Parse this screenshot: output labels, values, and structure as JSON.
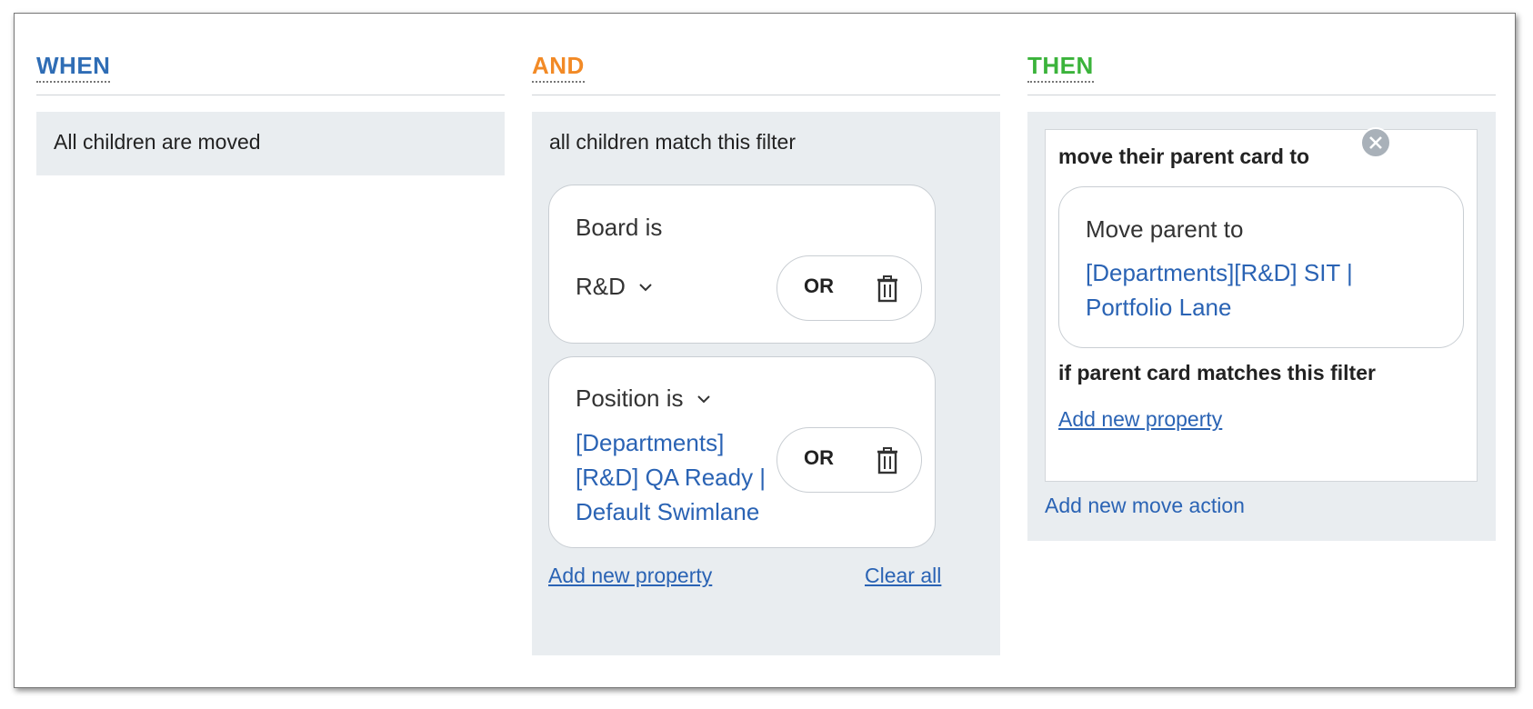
{
  "when": {
    "title": "WHEN",
    "trigger": "All children are moved"
  },
  "and": {
    "title": "AND",
    "filter_label": "all children match this filter",
    "conditions": [
      {
        "label": "Board is",
        "value": "R&D",
        "or_label": "OR"
      },
      {
        "label": "Position is",
        "value_lines": [
          "[Departments]",
          "[R&D] QA Ready |",
          "Default Swimlane"
        ],
        "or_label": "OR"
      }
    ],
    "add_property": "Add new property",
    "clear_all": "Clear all"
  },
  "then": {
    "title": "THEN",
    "action_label": "move their parent card to",
    "move_card": {
      "label": "Move parent to",
      "target_lines": [
        "[Departments][R&D] SIT |",
        "Portfolio Lane"
      ]
    },
    "parent_filter_label": "if parent card matches this filter",
    "add_property": "Add new property",
    "add_move_action": "Add new move action"
  },
  "colors": {
    "when": "#2f6db5",
    "and": "#f28a26",
    "then": "#3bb33b",
    "link": "#2a63b4",
    "panel_bg": "#e9edf0"
  },
  "icons": [
    "chevron-down-icon",
    "trash-icon",
    "close-icon"
  ]
}
